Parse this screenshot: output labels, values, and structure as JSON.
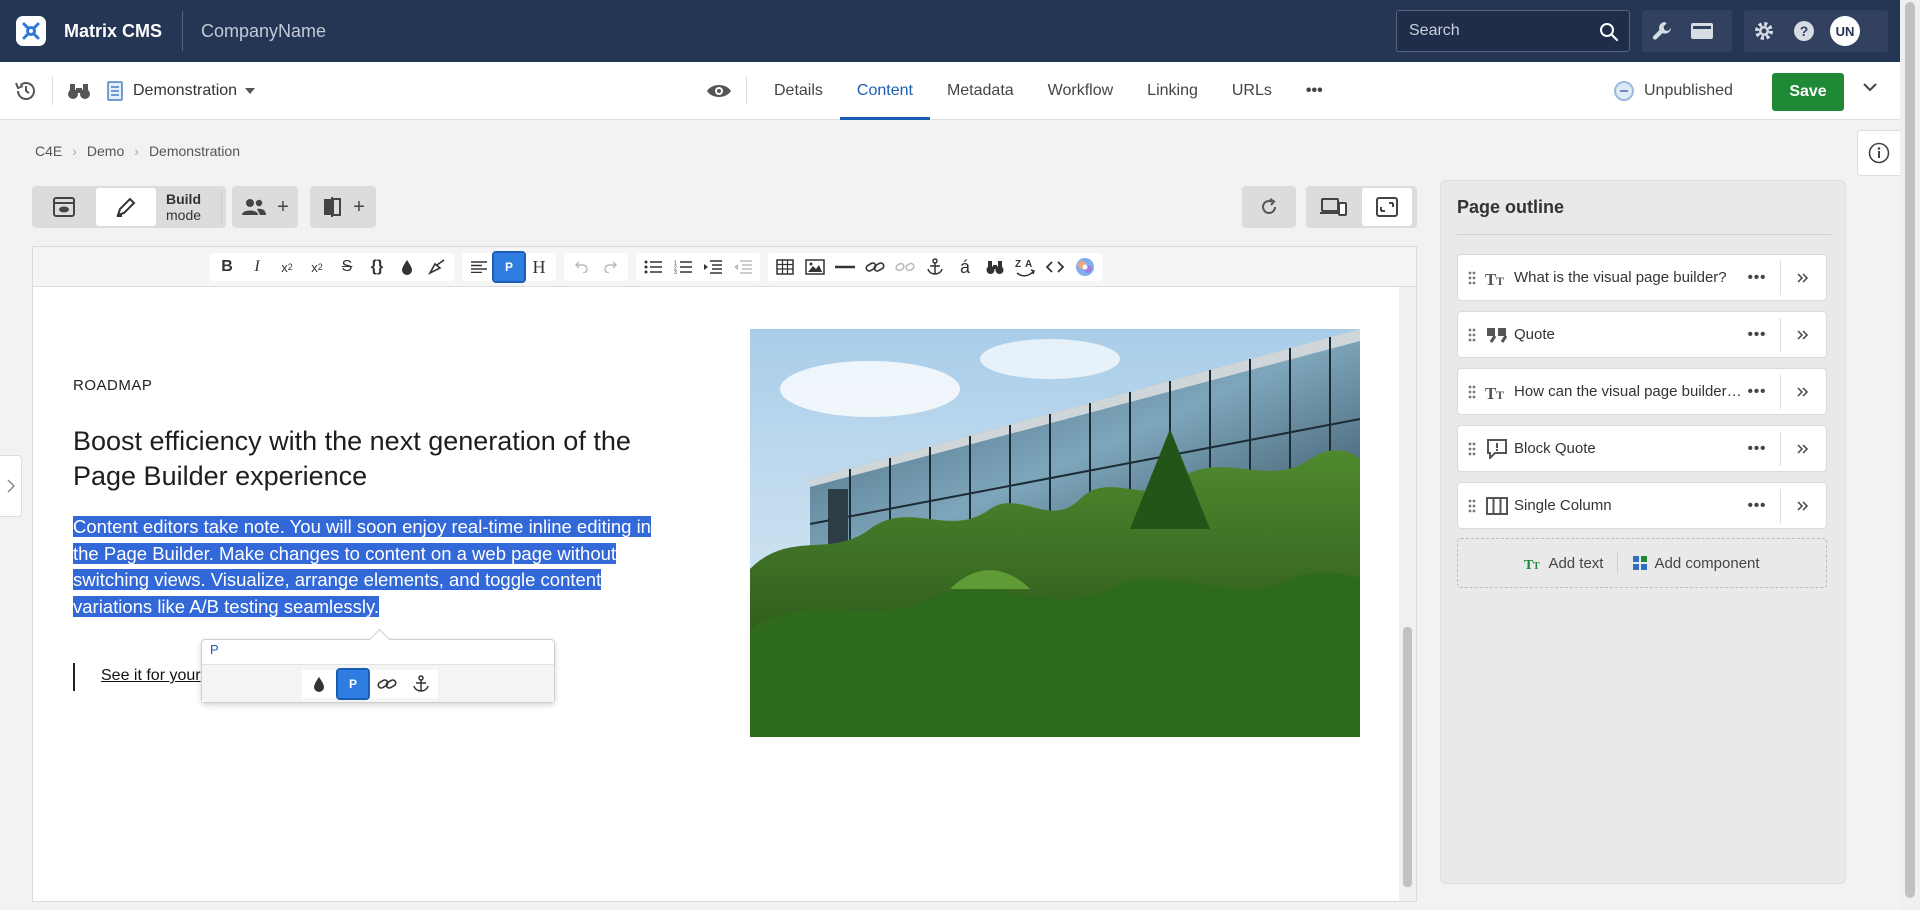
{
  "app": {
    "name": "Matrix CMS",
    "company": "CompanyName"
  },
  "search": {
    "placeholder": "Search"
  },
  "user": {
    "initials": "UN"
  },
  "subheader": {
    "asset_name": "Demonstration",
    "tabs": [
      {
        "label": "Details",
        "active": false
      },
      {
        "label": "Content",
        "active": true
      },
      {
        "label": "Metadata",
        "active": false
      },
      {
        "label": "Workflow",
        "active": false
      },
      {
        "label": "Linking",
        "active": false
      },
      {
        "label": "URLs",
        "active": false
      }
    ],
    "more": "•••",
    "status": "Unpublished",
    "save_label": "Save"
  },
  "breadcrumb": [
    "C4E",
    "Demo",
    "Demonstration"
  ],
  "mode": {
    "line1": "Build",
    "line2": "mode"
  },
  "toolbar": {
    "paragraph_tag": "P",
    "heading_tag": "H",
    "text_format": [
      "B",
      "I"
    ]
  },
  "content": {
    "eyebrow": "ROADMAP",
    "headline": "Boost efficiency with the next generation of the Page Builder experience",
    "body": "Content editors take note. You will soon enjoy real-time inline editing in the Page Builder. Make changes to content on a web page without switching views. Visualize, arrange elements, and toggle content variations like A/B testing seamlessly.",
    "cta": "See it for your"
  },
  "popover": {
    "tag": "P",
    "active_button": "P"
  },
  "outline": {
    "title": "Page outline",
    "items": [
      {
        "label": "What is the visual page builder?",
        "icon": "text-icon"
      },
      {
        "label": "Quote",
        "icon": "quote-icon"
      },
      {
        "label": "How can the visual page builder help?",
        "icon": "text-icon"
      },
      {
        "label": "Block Quote",
        "icon": "block-quote-icon"
      },
      {
        "label": "Single Column",
        "icon": "columns-icon"
      }
    ],
    "more": "•••",
    "add_text": "Add text",
    "add_component": "Add component"
  },
  "colors": {
    "topbar": "#253554",
    "accent": "#1a5eb3",
    "save": "#1f8a36",
    "selection": "#3368d8"
  }
}
